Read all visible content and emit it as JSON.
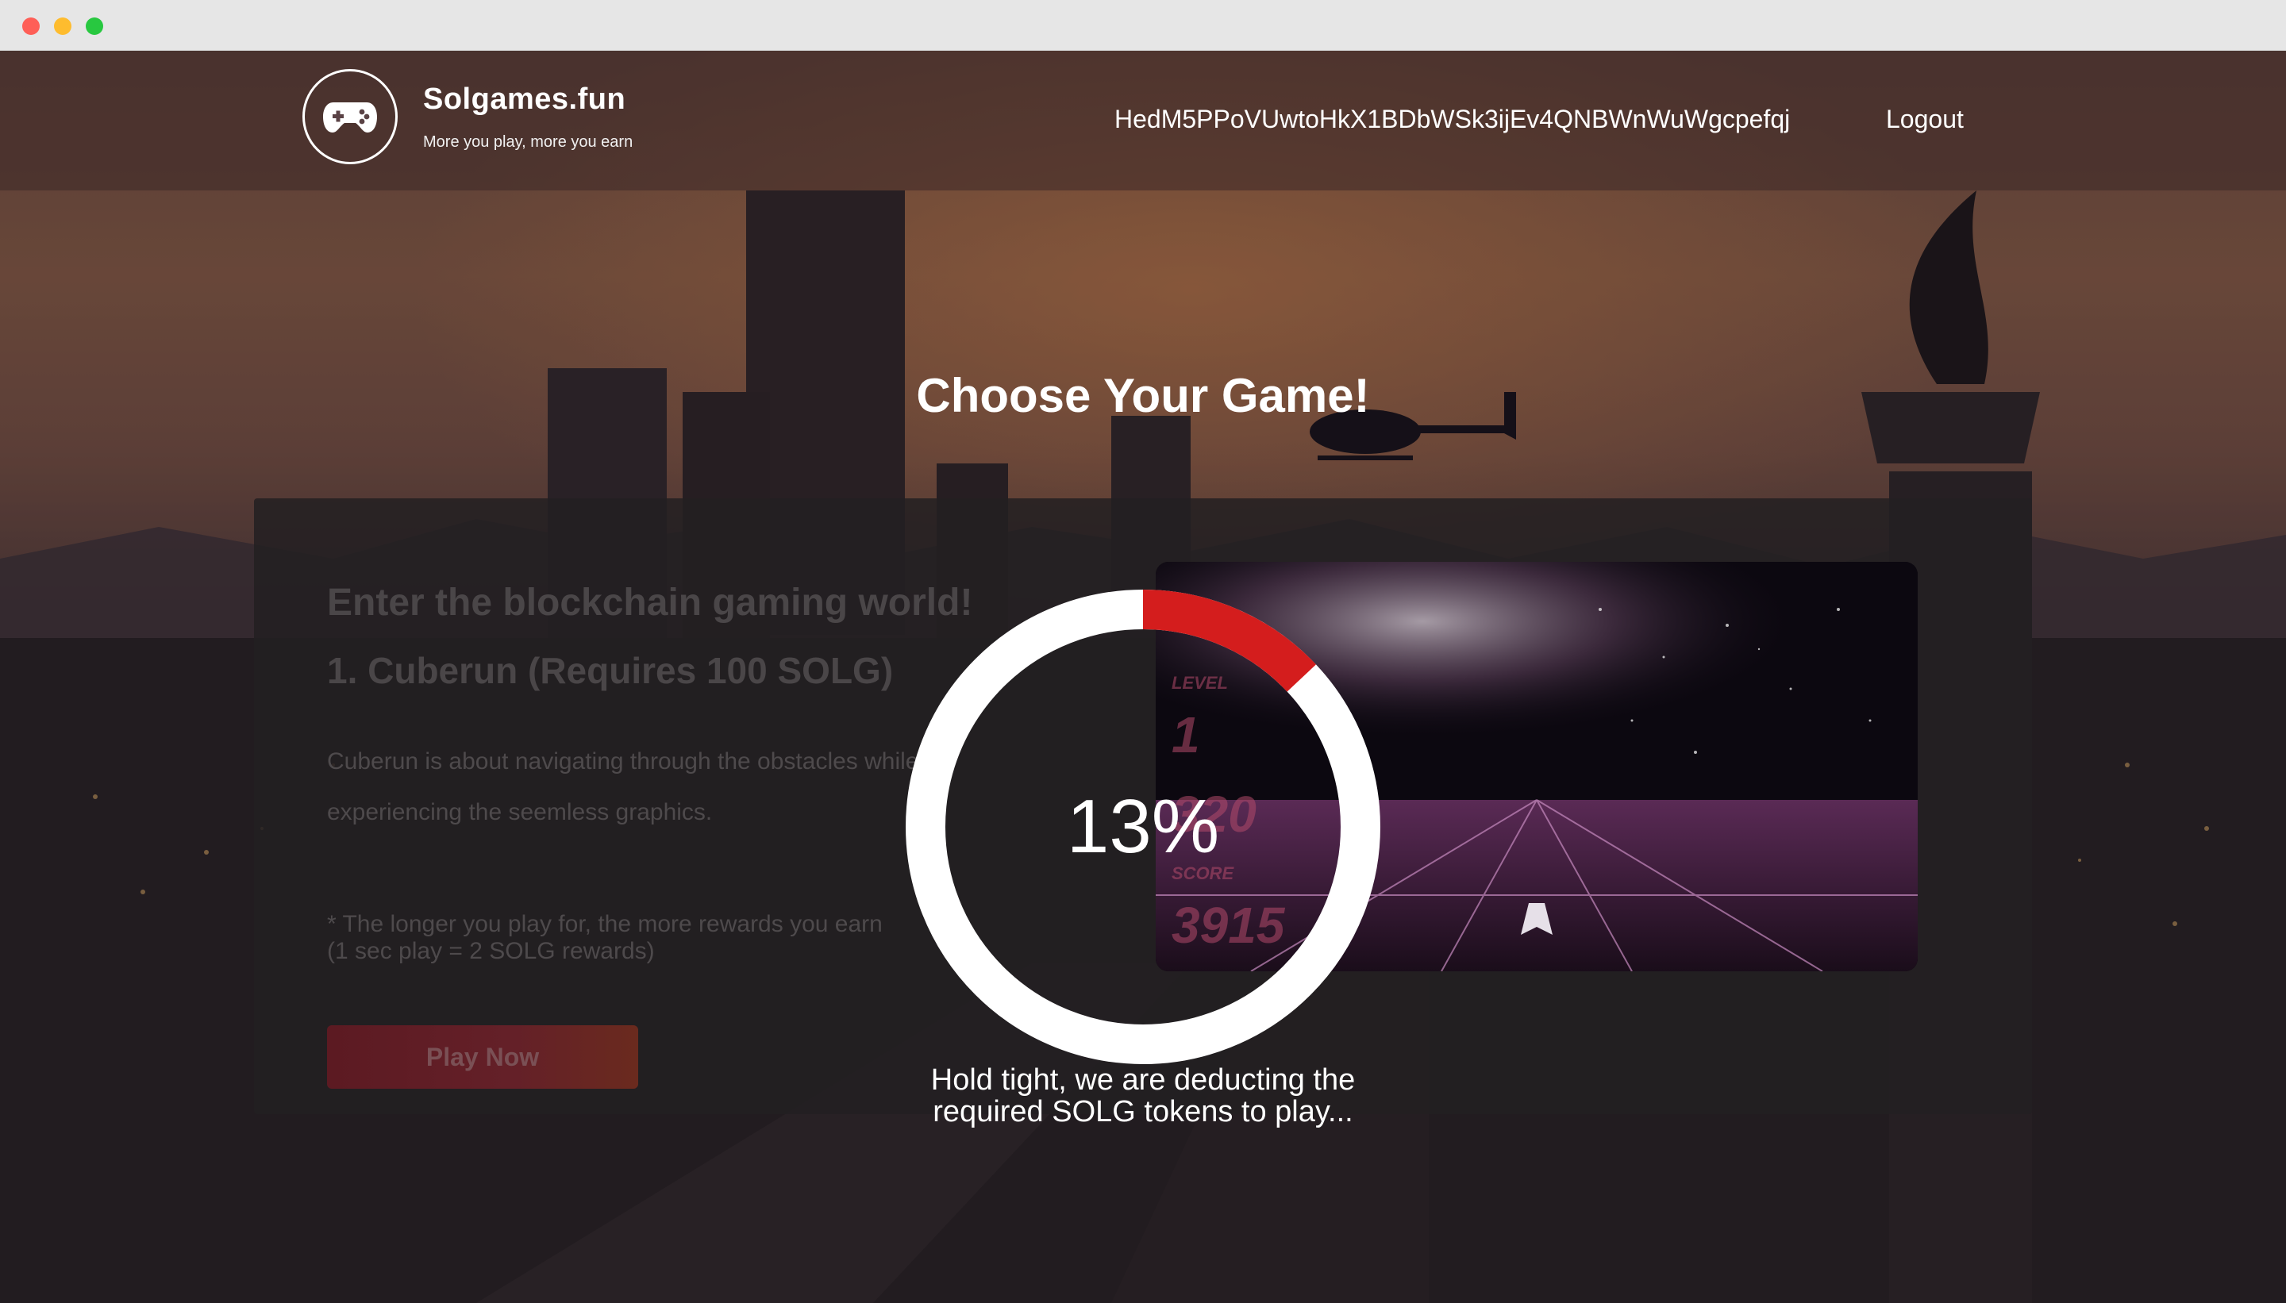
{
  "window": {
    "controls": [
      "close",
      "minimize",
      "maximize"
    ]
  },
  "header": {
    "brand_name": "Solgames.fun",
    "tagline": "More you play, more you earn",
    "wallet_address": "HedM5PPoVUwtoHkX1BDbWSk3ijEv4QNBWnWuWgcpefqj",
    "logout_label": "Logout",
    "logo_icon": "gamepad-icon"
  },
  "main": {
    "heading": "Choose Your Game!",
    "card": {
      "title": "Enter the blockchain gaming world!",
      "game_name": "1. Cuberun (Requires 100 SOLG)",
      "description": "Cuberun is about navigating through the obstacles while experiencing the seemless graphics.",
      "note_line1": "* The longer you play for, the more rewards you earn",
      "note_line2": "(1 sec play = 2 SOLG rewards)",
      "play_button_label": "Play Now",
      "preview_hud": {
        "level_label": "LEVEL",
        "level_value": "1",
        "speed_value": "320",
        "score_label": "SCORE",
        "score_value": "3915"
      }
    }
  },
  "loader": {
    "progress_fraction": 0.13,
    "progress_label": "13%",
    "message_line1": "Hold tight, we are deducting the",
    "message_line2": "required SOLG tokens to play...",
    "track_color": "#ffffff",
    "progress_color": "#d41d1d"
  }
}
